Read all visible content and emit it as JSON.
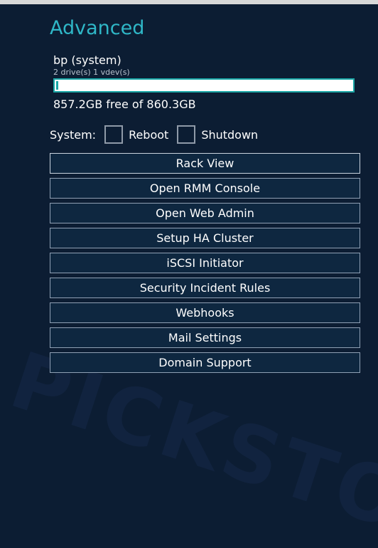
{
  "panel": {
    "title": "Advanced"
  },
  "pool": {
    "name": "bp (system)",
    "subtitle": "2 drive(s) 1 vdev(s)",
    "free_text": "857.2GB free of 860.3GB",
    "used_fraction": 0.0036
  },
  "system": {
    "label": "System:",
    "reboot_label": "Reboot",
    "shutdown_label": "Shutdown"
  },
  "buttons": {
    "rack_view": "Rack View",
    "open_rmm_console": "Open RMM Console",
    "open_web_admin": "Open Web Admin",
    "setup_ha_cluster": "Setup HA Cluster",
    "iscsi_initiator": "iSCSI Initiator",
    "security_incident_rules": "Security Incident Rules",
    "webhooks": "Webhooks",
    "mail_settings": "Mail Settings",
    "domain_support": "Domain Support"
  },
  "colors": {
    "background": "#0c1d33",
    "accent": "#2fb7c7",
    "bar_border": "#1aa6a6"
  }
}
